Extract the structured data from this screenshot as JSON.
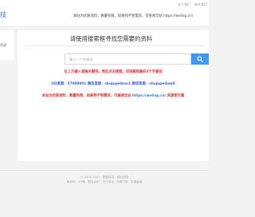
{
  "header": {
    "logo_fragment": "技",
    "link_about": "关于我们",
    "link_contact": "联系我们",
    "notice": "本站为优质资料，数量有限，如果找不到需求，可查阅全站 https://weliap.cn/"
  },
  "sidebar": {
    "item_text": "资源"
  },
  "main": {
    "title": "请使用搜索框寻找您需要的资料",
    "search_placeholder": "输入一个关键词",
    "line1": "在上方输入准确关键词，然后点击搜索，词语最短最好3个字最佳",
    "line2": "QQ客服：37099801 微信客服：shujupeiban1 微信客服：shujupeiban8",
    "line3_before": "本站为优质资料，数量有限，如果找不到需求，可查阅全站 ",
    "line3_link": "https://weliap.cn/",
    "line3_after": " 资源更丰富"
  },
  "footer": {
    "line1": "© 2005-2021 · 数据库站 · 网站地图",
    "line2": "备案号：ICP备 · 联系我们 · 关于本站 · 资源下载 · 友情链接"
  },
  "colors": {
    "accent": "#3f9bf2",
    "red": "#e23232",
    "blue": "#3b63d6"
  }
}
